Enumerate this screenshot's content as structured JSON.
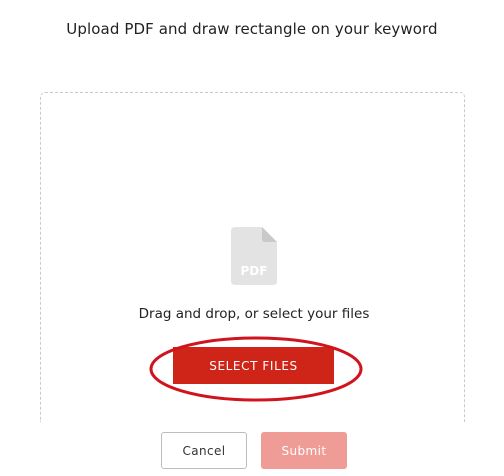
{
  "header": {
    "title": "Upload PDF and draw rectangle on your keyword"
  },
  "dropzone": {
    "file_icon": "pdf-file-icon",
    "file_icon_label": "PDF",
    "hint": "Drag and drop, or select your files",
    "select_button_label": "SELECT FILES"
  },
  "actions": {
    "cancel_label": "Cancel",
    "submit_label": "Submit",
    "submit_enabled": false
  },
  "colors": {
    "accent": "#cf2518",
    "annotation": "#d0141e",
    "submit_disabled": "#ee9c95",
    "icon_gray": "#e3e3e3"
  }
}
